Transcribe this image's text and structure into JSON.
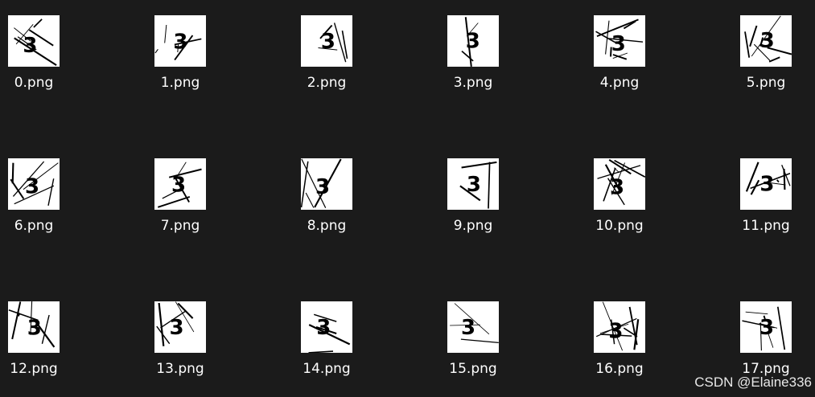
{
  "files": [
    {
      "name": "0.png",
      "icon": "captcha-image-thumbnail"
    },
    {
      "name": "1.png",
      "icon": "captcha-image-thumbnail"
    },
    {
      "name": "2.png",
      "icon": "captcha-image-thumbnail"
    },
    {
      "name": "3.png",
      "icon": "captcha-image-thumbnail"
    },
    {
      "name": "4.png",
      "icon": "captcha-image-thumbnail"
    },
    {
      "name": "5.png",
      "icon": "captcha-image-thumbnail"
    },
    {
      "name": "6.png",
      "icon": "captcha-image-thumbnail"
    },
    {
      "name": "7.png",
      "icon": "captcha-image-thumbnail"
    },
    {
      "name": "8.png",
      "icon": "captcha-image-thumbnail"
    },
    {
      "name": "9.png",
      "icon": "captcha-image-thumbnail"
    },
    {
      "name": "10.png",
      "icon": "captcha-image-thumbnail"
    },
    {
      "name": "11.png",
      "icon": "captcha-image-thumbnail"
    },
    {
      "name": "12.png",
      "icon": "captcha-image-thumbnail"
    },
    {
      "name": "13.png",
      "icon": "captcha-image-thumbnail"
    },
    {
      "name": "14.png",
      "icon": "captcha-image-thumbnail"
    },
    {
      "name": "15.png",
      "icon": "captcha-image-thumbnail"
    },
    {
      "name": "16.png",
      "icon": "captcha-image-thumbnail"
    },
    {
      "name": "17.png",
      "icon": "captcha-image-thumbnail"
    }
  ],
  "thumbnail_glyph": "3",
  "watermark": "CSDN @Elaine336",
  "colors": {
    "background": "#1b1b1b",
    "label_text": "#ffffff",
    "thumbnail_bg": "#ffffff",
    "thumbnail_ink": "#000000"
  }
}
